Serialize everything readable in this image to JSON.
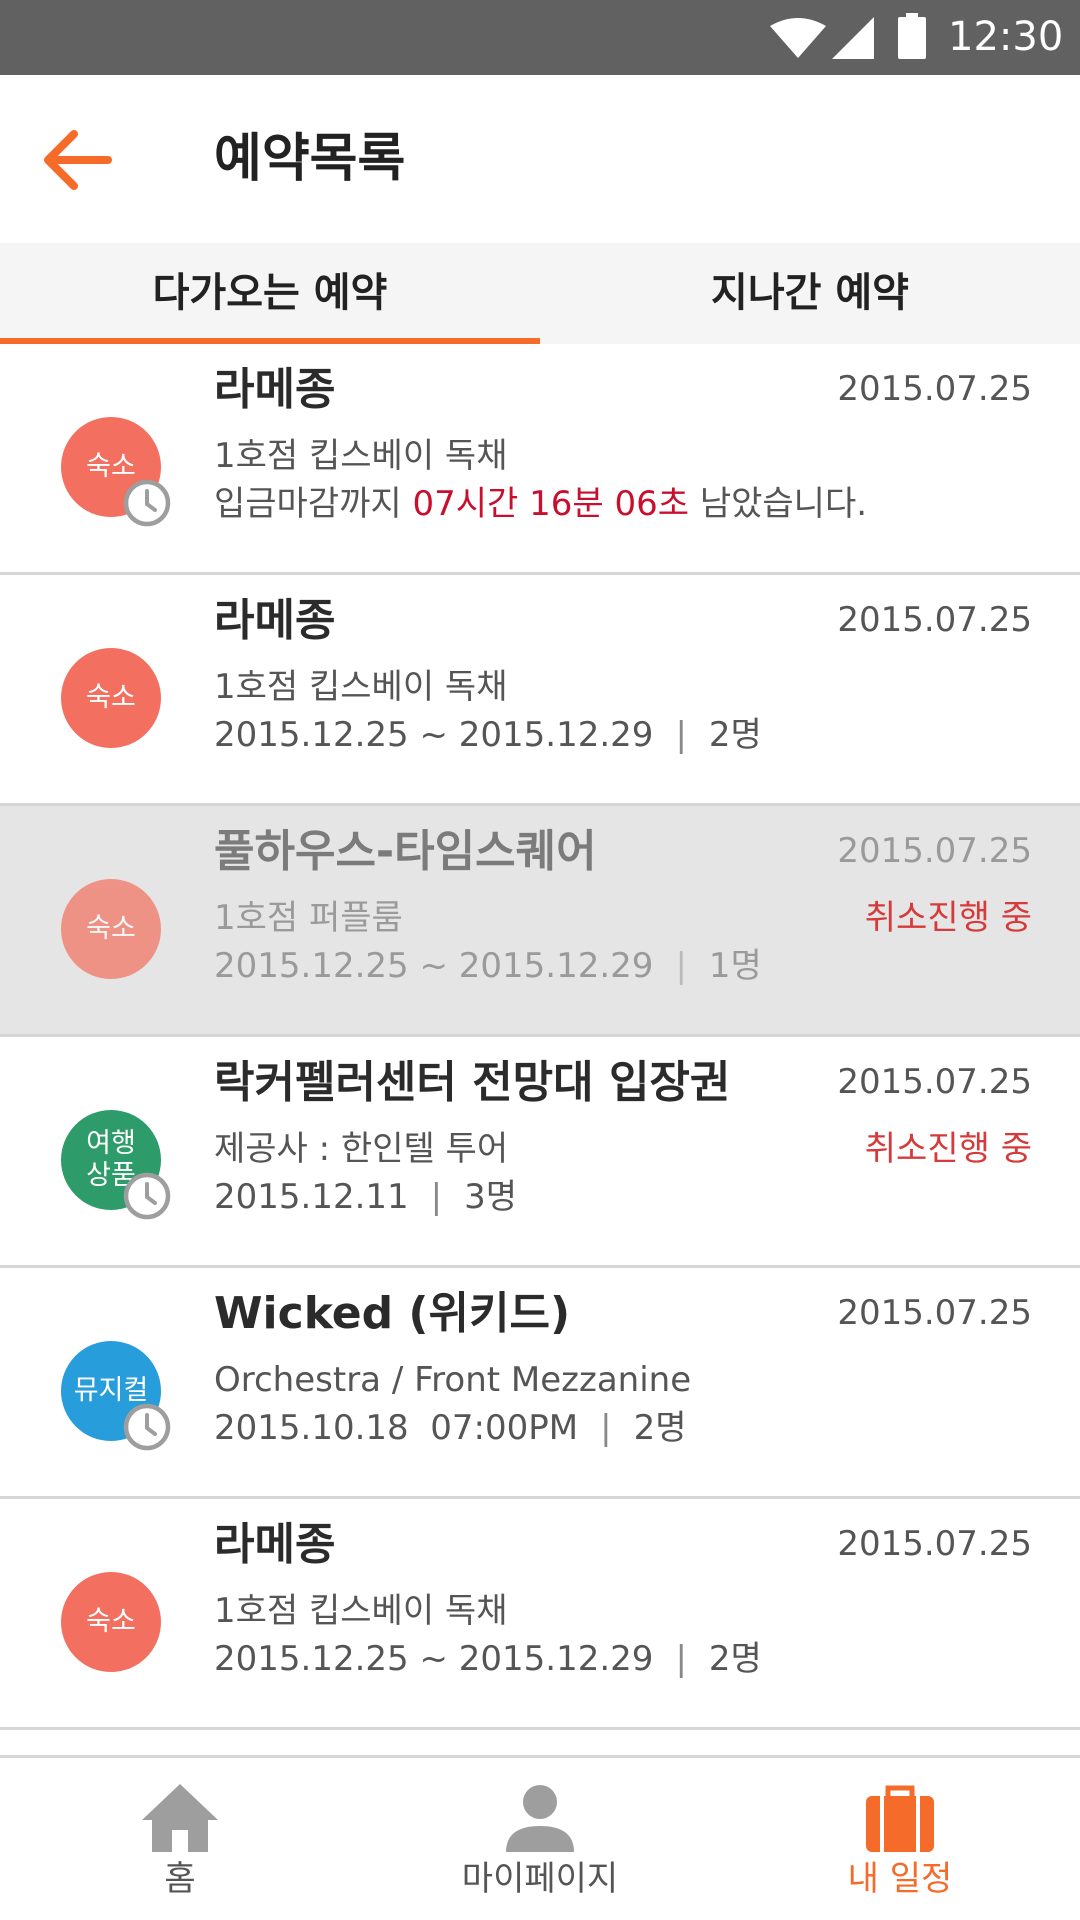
{
  "status_bar": {
    "time": "12:30"
  },
  "header": {
    "title": "예약목록"
  },
  "tabs": [
    {
      "label": "다가오는 예약",
      "active": true
    },
    {
      "label": "지나간 예약",
      "active": false
    }
  ],
  "colors": {
    "accent": "#f56b2a",
    "stay": "#f36f5f",
    "tour": "#2e9b6a",
    "musical": "#279ddb",
    "alert": "#d63a3a"
  },
  "reservations": [
    {
      "category": "숙소",
      "title": "라메종",
      "sub": "1호점 킵스베이 독채",
      "date": "2015.07.25",
      "notice_prefix": "입금마감까지 ",
      "notice_time": "07시간 16분 06초",
      "notice_suffix": " 남았습니다.",
      "pending": true
    },
    {
      "category": "숙소",
      "title": "라메종",
      "sub": "1호점 킵스베이 독채",
      "date": "2015.07.25",
      "period": "2015.12.25 ~ 2015.12.29",
      "people": "2명"
    },
    {
      "category": "숙소",
      "title": "풀하우스-타임스퀘어",
      "sub": "1호점 퍼플룸",
      "date": "2015.07.25",
      "status": "취소진행 중",
      "period": "2015.12.25 ~ 2015.12.29",
      "people": "1명"
    },
    {
      "category_line1": "여행",
      "category_line2": "상품",
      "title": "락커펠러센터 전망대 입장권",
      "sub": "제공사 : 한인텔 투어",
      "date": "2015.07.25",
      "status": "취소진행 중",
      "period": "2015.12.11",
      "people": "3명",
      "pending": true
    },
    {
      "category": "뮤지컬",
      "title": "Wicked (위키드)",
      "sub": "Orchestra / Front Mezzanine",
      "date": "2015.07.25",
      "period": "2015.10.18  07:00PM",
      "people": "2명",
      "pending": true
    },
    {
      "category": "숙소",
      "title": "라메종",
      "sub": "1호점 킵스베이 독채",
      "date": "2015.07.25",
      "period": "2015.12.25 ~ 2015.12.29",
      "people": "2명"
    }
  ],
  "bottom_nav": [
    {
      "label": "홈",
      "icon": "home-icon"
    },
    {
      "label": "마이페이지",
      "icon": "person-icon"
    },
    {
      "label": "내 일정",
      "icon": "suitcase-icon",
      "active": true
    }
  ]
}
